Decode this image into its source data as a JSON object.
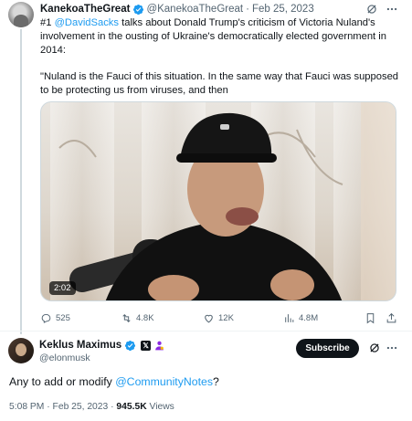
{
  "quoted_tweet": {
    "author_name": "KanekoaTheGreat",
    "handle": "@KanekoaTheGreat",
    "separator": "·",
    "date": "Feb 25, 2023",
    "text_line1_prefix": "#1 ",
    "text_mention": "@DavidSacks",
    "text_line1_rest": " talks about Donald Trump's criticism of Victoria Nuland's involvement in the ousting of Ukraine's democratically elected government in 2014:",
    "text_quote": "\"Nuland is the Fauci of this situation. In the same way that Fauci was supposed to be protecting us from viruses, and then",
    "video_duration": "2:02",
    "actions": {
      "replies": "525",
      "reposts": "4.8K",
      "likes": "12K",
      "views": "4.8M"
    }
  },
  "main_tweet": {
    "author_name": "Keklus Maximus",
    "x_badge": "𝕏",
    "handle": "@elonmusk",
    "subscribe_label": "Subscribe",
    "text_prefix": "Any to add or modify ",
    "text_mention": "@CommunityNotes",
    "text_suffix": "?",
    "time": "5:08 PM",
    "separator": "·",
    "date": "Feb 25, 2023",
    "views_count": "945.5K",
    "views_label": "Views"
  },
  "icons": {
    "verified": "verified-badge-icon",
    "grok": "grok-icon",
    "more": "more-icon",
    "reply": "reply-icon",
    "repost": "repost-icon",
    "like": "like-icon",
    "views": "views-icon",
    "bookmark": "bookmark-icon",
    "share": "share-icon",
    "affiliate": "affiliate-badge-icon"
  },
  "colors": {
    "accent": "#1d9bf0",
    "text": "#0f1419",
    "muted": "#536471",
    "affiliate": "#8b2be2"
  }
}
